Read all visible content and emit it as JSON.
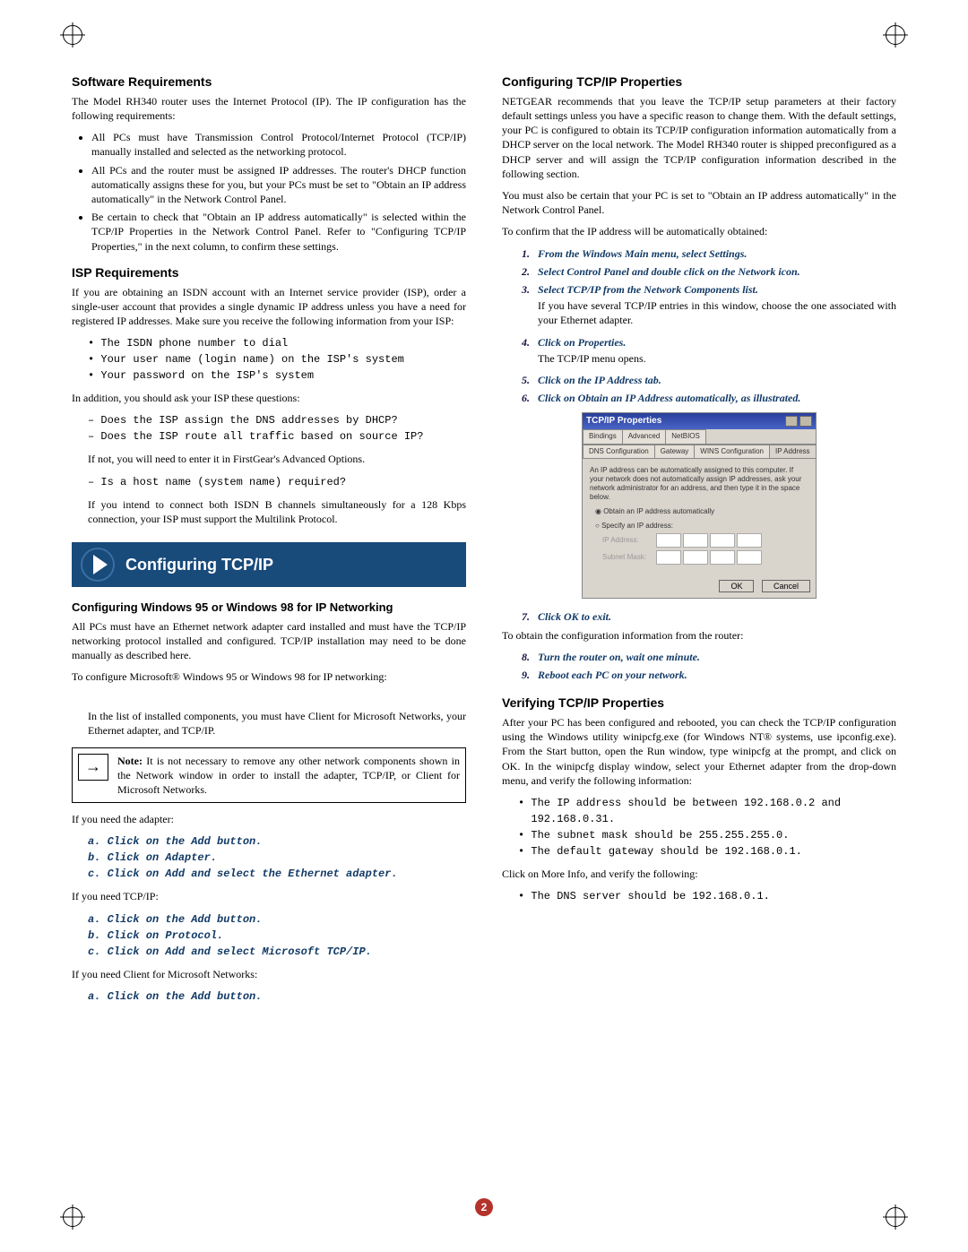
{
  "page_number": "2",
  "left": {
    "h_software": "Software Requirements",
    "p_software_intro": "The Model RH340 router uses the Internet Protocol (IP). The IP configuration has the following requirements:",
    "bullets_software": [
      "All PCs must have Transmission Control Protocol/Internet Protocol (TCP/IP) manually installed and selected as the networking protocol.",
      "All PCs and the router must be assigned IP addresses. The router's DHCP function automatically assigns these for you, but your PCs must be set to \"Obtain an IP address automatically\" in the Network Control Panel.",
      "Be certain to check that \"Obtain an IP address automatically\" is selected within the TCP/IP Properties in the Network Control Panel. Refer to \"Configuring TCP/IP Properties,\" in the next column, to confirm these settings."
    ],
    "h_isp": "ISP Requirements",
    "p_isp_intro": "If you are obtaining an ISDN account with an Internet service provider (ISP), order a single-user account that provides a single dynamic IP address unless you have a need for registered IP addresses. Make sure you receive the following information from your ISP:",
    "isp_block": "• The ISDN phone number to dial\n• Your user name (login name) on the ISP's system\n• Your password on the ISP's system",
    "p_isp_addition": "In addition, you should ask your ISP these questions:",
    "isp_q_block": "– Does the ISP assign the DNS addresses by DHCP?\n– Does the ISP route all traffic based on source IP?",
    "p_isp_enter": "If not, you will need to enter it in FirstGear's Advanced Options.",
    "isp_host_block": "– Is a host name (system name) required?",
    "p_isp_multilink": "If you intend to connect both ISDN B channels simultaneously for a 128 Kbps connection, your ISP must support the Multilink Protocol.",
    "banner_title": "Configuring TCP/IP",
    "h_win9598": "Configuring Windows 95 or Windows 98 for IP Networking",
    "p_allpcs": "All PCs must have an Ethernet network adapter card installed and must have the TCP/IP networking protocol installed and configured. TCP/IP installation may need to be done manually as described here.",
    "p_configure_ms": "To configure Microsoft® Windows 95 or Windows 98 for IP networking:",
    "p_installed_list": "In the list of installed components, you must have Client for Microsoft Networks, your Ethernet adapter, and TCP/IP.",
    "note_label": "Note:",
    "note_text": "It is not necessary to remove any other network components shown in the Network window in order to install the adapter, TCP/IP, or Client for Microsoft Networks.",
    "p_need_adapter": "If you need the adapter:",
    "adapter_block": "a. Click on the Add button.\nb. Click on Adapter.\nc. Click on Add and select the Ethernet adapter.",
    "p_need_tcpip": "If you need TCP/IP:",
    "tcpip_block": "a. Click on the Add button.\nb. Click on Protocol.\nc. Click on Add and select Microsoft TCP/IP.",
    "p_need_client": "If you need Client for Microsoft Networks:",
    "client_block": "a. Click on the Add button."
  },
  "right": {
    "h_conf_tcpip": "Configuring TCP/IP Properties",
    "p_netgear_rec": "NETGEAR recommends that you leave the TCP/IP setup parameters at their factory default settings unless you have a specific reason to change them. With the default settings, your PC is configured to obtain its TCP/IP configuration information automatically from a DHCP server on the local network. The Model RH340 router is shipped preconfigured as a DHCP server and will assign the TCP/IP configuration information described in the following section.",
    "p_must_also": "You must also be certain that your PC is set to \"Obtain an IP address automatically\" in the Network Control Panel.",
    "p_to_confirm": "To confirm that the IP address will be automatically obtained:",
    "step1_n": "1.",
    "step1": "From the Windows Main menu, select Settings.",
    "step2_n": "2.",
    "step2": "Select Control Panel and double click on the Network icon.",
    "step3_n": "3.",
    "step3": "Select TCP/IP from the Network Components list.",
    "step3_body": "If you have several TCP/IP entries in this window, choose the one associated with your Ethernet adapter.",
    "step4_n": "4.",
    "step4": "Click on Properties.",
    "step4_body": "The TCP/IP menu opens.",
    "step5_n": "5.",
    "step5": "Click on the IP Address tab.",
    "step6_n": "6.",
    "step6": "Click on Obtain an IP Address automatically, as illustrated.",
    "tcp_title": "TCP/IP Properties",
    "tcp_tabs_row1": [
      "Bindings",
      "Advanced",
      "NetBIOS"
    ],
    "tcp_tabs_row2": [
      "DNS Configuration",
      "Gateway",
      "WINS Configuration",
      "IP Address"
    ],
    "tcp_blurb": "An IP address can be automatically assigned to this computer. If your network does not automatically assign IP addresses, ask your network administrator for an address, and then type it in the space below.",
    "tcp_radio1": "Obtain an IP address automatically",
    "tcp_radio2": "Specify an IP address:",
    "tcp_ip_label": "IP Address:",
    "tcp_sub_label": "Subnet Mask:",
    "tcp_ok": "OK",
    "tcp_cancel": "Cancel",
    "step7_n": "7.",
    "step7": "Click OK to exit.",
    "p_obtain_conf": "To obtain the configuration information from the router:",
    "step8_n": "8.",
    "step8": "Turn the router on, wait one minute.",
    "step9_n": "9.",
    "step9": "Reboot each PC on your network.",
    "h_verify": "Verifying TCP/IP Properties",
    "p_verify": "After your PC has been configured and rebooted, you can check the TCP/IP configuration using the Windows utility winipcfg.exe (for Windows NT® systems, use ipconfig.exe). From the Start button, open the Run window, type winipcfg at the prompt, and click on OK. In the winipcfg display window, select your Ethernet adapter from the drop-down menu, and verify the following information:",
    "verify_block": "• The IP address should be between 192.168.0.2 and\n  192.168.0.31.\n• The subnet mask should be 255.255.255.0.\n• The default gateway should be 192.168.0.1.",
    "p_more_info": "Click on More Info, and verify the following:",
    "more_info_block": "• The DNS server should be 192.168.0.1."
  }
}
